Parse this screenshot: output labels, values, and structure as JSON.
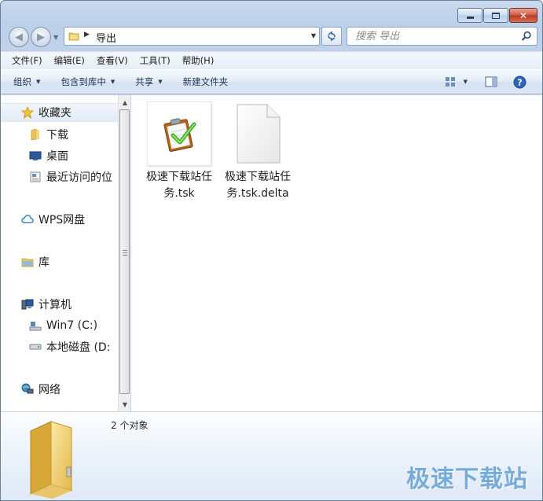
{
  "window": {
    "caption": {
      "minimize": "▭",
      "maximize": "□",
      "close": "✕"
    }
  },
  "address": {
    "path": "导出"
  },
  "search": {
    "placeholder": "搜索 导出"
  },
  "menu": [
    "文件(F)",
    "编辑(E)",
    "查看(V)",
    "工具(T)",
    "帮助(H)"
  ],
  "commands": [
    "组织",
    "包含到库中",
    "共享",
    "新建文件夹"
  ],
  "nav": {
    "favorites": "收藏夹",
    "downloads": "下载",
    "desktop": "桌面",
    "recent": "最近访问的位",
    "wps": "WPS网盘",
    "library": "库",
    "computer": "计算机",
    "drive_c": "Win7 (C:)",
    "drive_d": "本地磁盘 (D:",
    "network": "网络"
  },
  "files": [
    {
      "name": "极速下载站任务.tsk",
      "icon": "task-clipboard-icon"
    },
    {
      "name": "极速下载站任务.tsk.delta",
      "icon": "blank-file-icon"
    }
  ],
  "details": {
    "count": "2 个对象"
  },
  "watermark": "极速下载站",
  "colors": {
    "accent": "#6ea7d8",
    "selection": "#e3ebf5"
  }
}
